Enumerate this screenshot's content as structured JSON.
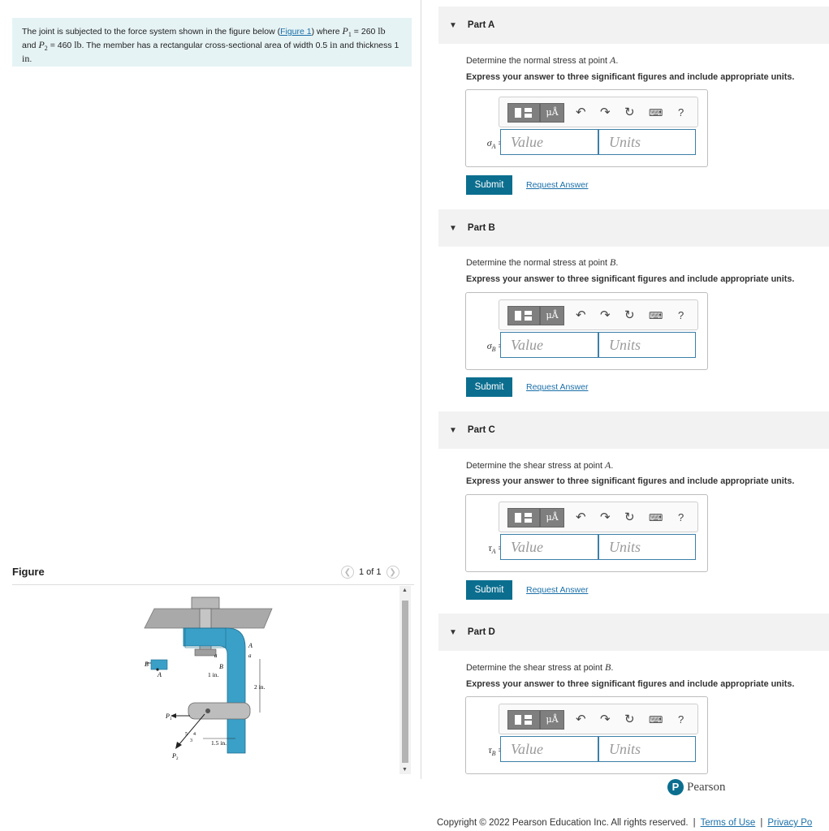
{
  "problem": {
    "text_1": "The joint is subjected to the force system shown in the figure below (",
    "figure_link": "Figure 1",
    "text_2": ") where ",
    "p1_symbol": "P",
    "p1_sub": "1",
    "p1_value": " = 260 ",
    "unit_lb": "lb",
    "text_3": "and ",
    "p2_symbol": "P",
    "p2_sub": "2",
    "p2_value": " = 460 ",
    "text_4": ". The member has a rectangular cross-sectional area of width 0.5 ",
    "unit_in": "in",
    "text_5": " and thickness 1 ",
    "text_6": "."
  },
  "figure": {
    "title": "Figure",
    "pager": "1 of 1",
    "labels": {
      "A": "A",
      "B": "B",
      "a": "a",
      "dim_1in": "1 in.",
      "dim_2in": "2 in.",
      "dim_15in": "1.5 in.",
      "P1": "P",
      "P1sub": "1",
      "P2": "P",
      "P2sub": "2",
      "n5": "5",
      "n4": "4",
      "n3": "3"
    }
  },
  "parts": [
    {
      "label": "Part A",
      "question": "Determine the normal stress at point ",
      "point": "A",
      "instruction": "Express your answer to three significant figures and include appropriate units.",
      "symbol": "σ",
      "sub": "A",
      "value_placeholder": "Value",
      "units_placeholder": "Units",
      "submit": "Submit",
      "request": "Request Answer"
    },
    {
      "label": "Part B",
      "question": "Determine the normal stress at point ",
      "point": "B",
      "instruction": "Express your answer to three significant figures and include appropriate units.",
      "symbol": "σ",
      "sub": "B",
      "value_placeholder": "Value",
      "units_placeholder": "Units",
      "submit": "Submit",
      "request": "Request Answer"
    },
    {
      "label": "Part C",
      "question": "Determine the shear stress at point ",
      "point": "A",
      "instruction": "Express your answer to three significant figures and include appropriate units.",
      "symbol": "τ",
      "sub": "A",
      "value_placeholder": "Value",
      "units_placeholder": "Units",
      "submit": "Submit",
      "request": "Request Answer"
    },
    {
      "label": "Part D",
      "question": "Determine the shear stress at point ",
      "point": "B",
      "instruction": "Express your answer to three significant figures and include appropriate units.",
      "symbol": "τ",
      "sub": "B",
      "value_placeholder": "Value",
      "units_placeholder": "Units"
    }
  ],
  "toolbar": {
    "mu_label": "μÅ",
    "undo_icon": "undo-icon",
    "redo_icon": "redo-icon",
    "reset_icon": "reset-icon",
    "keyboard_icon": "keyboard-icon",
    "help_label": "?"
  },
  "brand": {
    "logo_letter": "P",
    "name": "Pearson"
  },
  "footer": {
    "copyright": "Copyright © 2022 Pearson Education Inc. All rights reserved.",
    "sep": "|",
    "terms": "Terms of Use",
    "privacy": "Privacy Po"
  },
  "colors": {
    "accent": "#0b6e8f",
    "link": "#1a6fa8",
    "problem_bg": "#e6f3f5",
    "member_blue": "#3aa0c8"
  }
}
